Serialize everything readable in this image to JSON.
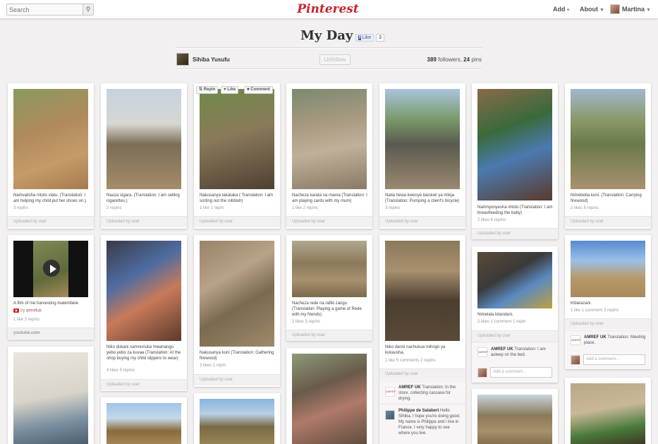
{
  "header": {
    "search_placeholder": "Search",
    "search_icon": "search-icon",
    "logo": "Pinterest",
    "add": "Add",
    "about": "About",
    "user": "Martina"
  },
  "board": {
    "title": "My Day",
    "fb_like": "Like",
    "fb_count": "3",
    "owner": "Sihiba Yusufu",
    "unfollow": "Unfollow",
    "followers_count": "389",
    "followers_label": "followers,",
    "pins_count": "24",
    "pins_label": "pins"
  },
  "actions": {
    "repin": "Repin",
    "like": "Like",
    "comment": "Comment"
  },
  "pins": [
    {
      "caption": "Namvalisha mtoto viatu. (Translation: I am helping my child put her shoes on.)",
      "meta": "3 repins",
      "footer": "Uploaded by user"
    },
    {
      "caption": "Nauza sigara. (Translation: I am selling cigarettes.)",
      "meta": "2 repins",
      "footer": "Uploaded by user"
    },
    {
      "caption": "Nakusanya takataka ( Translation: I am sorting out the rubbish)",
      "meta": "1 like   1 repin",
      "footer": "Uploaded by user"
    },
    {
      "caption": "Nacheza karata na mama (Translation: I am playing cards with my mum)",
      "meta": "1 like   2 repins",
      "footer": "Uploaded by user"
    },
    {
      "caption": "Natia hewa kwenye baiskeli ya mteja (Translation: Pumping a client's bicycle)",
      "meta": "3 repins",
      "footer": "Uploaded by user"
    },
    {
      "caption": "Namnyonyesha mtoto (Translation: I am breastfeeding the baby)",
      "meta": "2 likes   6 repins",
      "footer": "Uploaded by user"
    },
    {
      "caption": "Nimebeba kuni. (Translation: Carrying firewood)",
      "meta": "2 likes   6 repins",
      "footer": "Uploaded by user"
    },
    {
      "caption": "A film of me harvesting matembele",
      "by": "by",
      "source": "amrefuk",
      "meta": "1 like   3 repins",
      "footer": "youtube.com"
    },
    {
      "caption": "Niko dukani namnunulia mwanangu yebo yebo za kuvaa (Translation: At the shop buying my child slippers to wear)",
      "meta": "4 likes   5 repins",
      "footer": "Uploaded by user"
    },
    {
      "caption": "Nakusanya kuni (Translation: Gathering firewood)",
      "meta": "3 likes   1 repin",
      "footer": "Uploaded by user"
    },
    {
      "caption": "Nacheza rede na rafiki zangu (Translation: Playing a game of Rede with my friends)",
      "meta": "2 likes   3 repins",
      "footer": "Uploaded by user"
    },
    {
      "caption": "Niko darini nachukua mihogo ya kukausha.",
      "meta": "1 like   5 comments   2 repins",
      "footer": "Uploaded by user",
      "comments": [
        {
          "author": "AMREF UK",
          "text": "Translation: In the store, collecting cassava for drying."
        },
        {
          "author": "Philippe de Salabert",
          "text": "Hello Sihiba, I hope you're doing good. My name is Philippe and i live in France. I very happy to see where you live."
        }
      ]
    },
    {
      "caption": "Nimelala kitandani.",
      "meta": "2 likes   1 comment   1 repin",
      "footer": "Uploaded by user",
      "comments": [
        {
          "author": "AMREF UK",
          "text": "Translation: I am asleep on the bed."
        }
      ],
      "add_comment": "Add a comment..."
    },
    {
      "caption": "Kibarazani.",
      "meta": "1 like   1 comment   3 repins",
      "footer": "Uploaded by user",
      "comments": [
        {
          "author": "AMREF UK",
          "text": "Translation: Meeting place."
        }
      ],
      "add_comment": "Add a comment..."
    }
  ]
}
